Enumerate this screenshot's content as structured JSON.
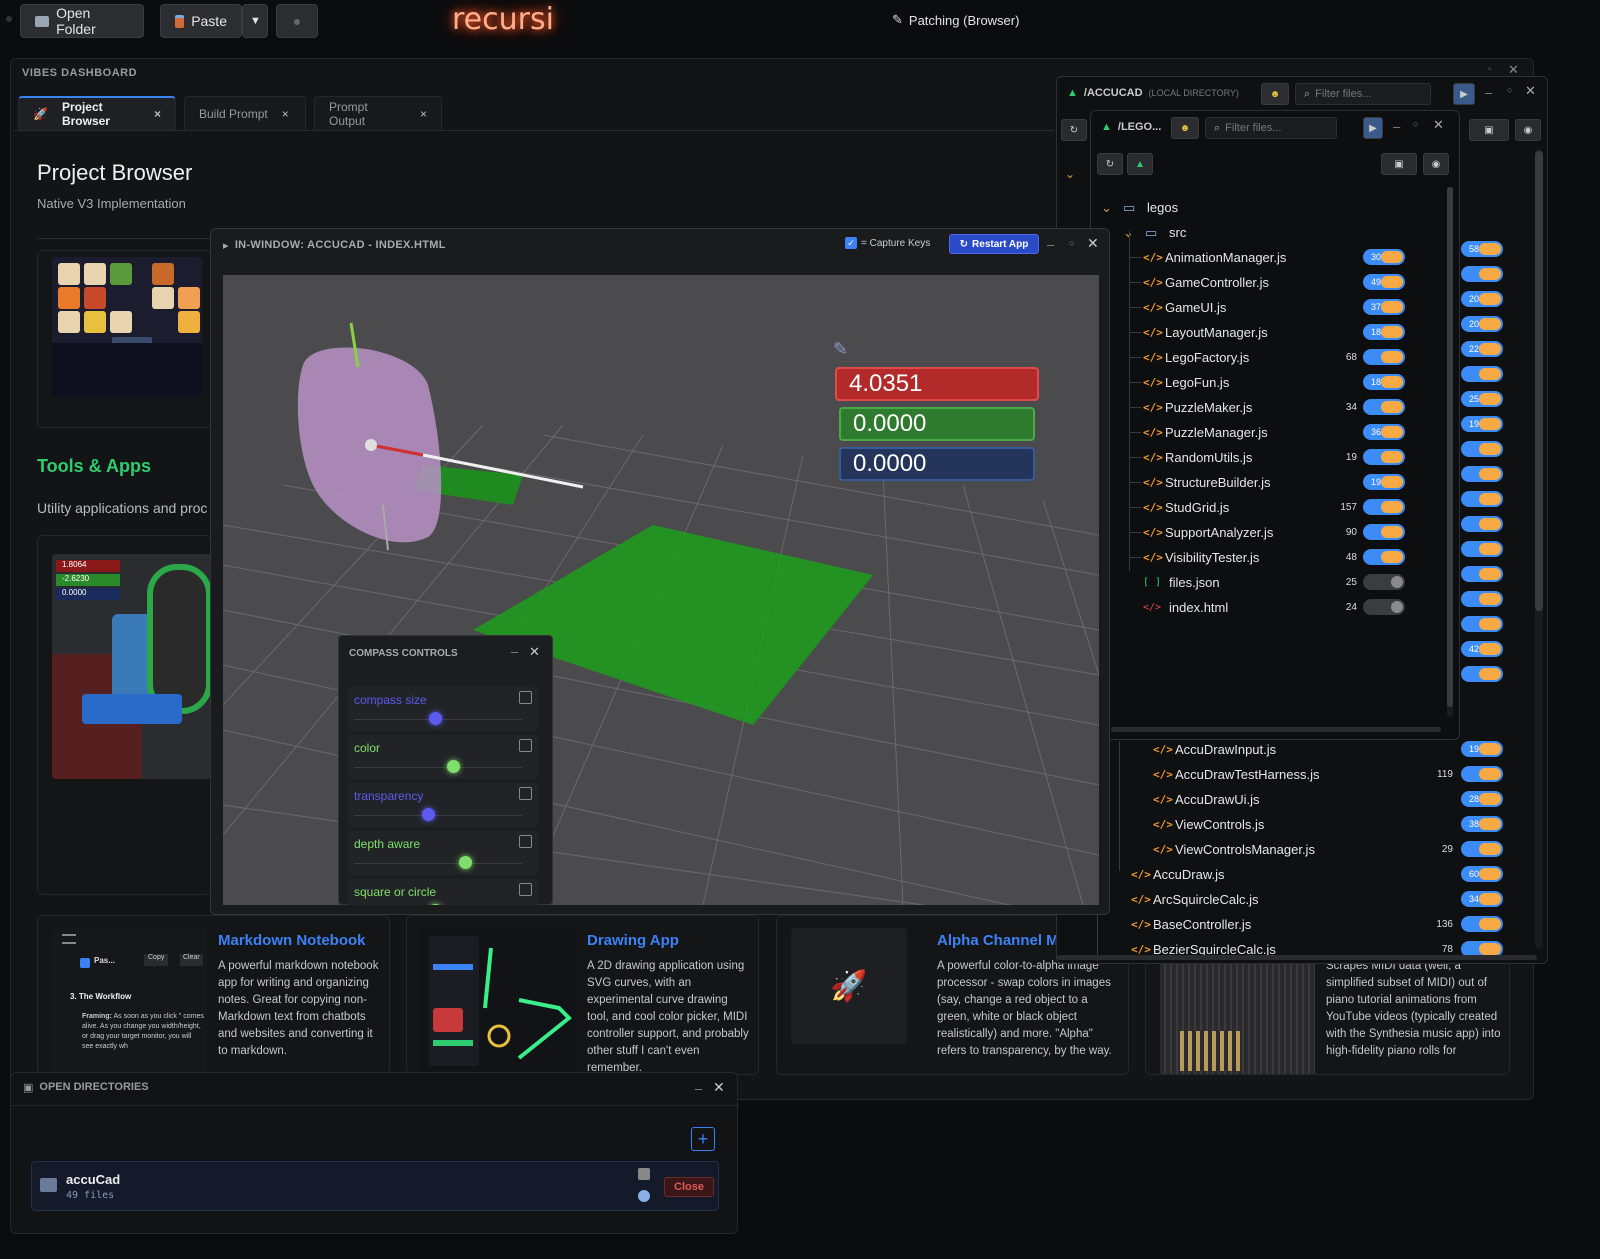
{
  "toolbar": {
    "open_folder": "Open Folder",
    "paste": "Paste",
    "paste_dropdown": "▼",
    "brand": "recursi",
    "status": "Patching (Browser)"
  },
  "dashboard": {
    "title": "VIBES DASHBOARD",
    "tabs": [
      {
        "label": "Project Browser",
        "close": "×"
      },
      {
        "label": "Build Prompt",
        "close": "×"
      },
      {
        "label": "Prompt Output",
        "close": "×"
      }
    ],
    "heading": "Project Browser",
    "subheading": "Native V3 Implementation",
    "section_title": "Tools & Apps",
    "section_desc": "Utility applications and proc",
    "cards": [
      {
        "title": "Markdown Notebook",
        "desc": "A powerful markdown notebook app for writing and organizing notes. Great for copying non-Markdown text from chatbots and websites and converting it to markdown."
      },
      {
        "title": "Drawing App",
        "desc": "A 2D drawing application using SVG curves, with an experimental curve drawing tool, and cool color picker, MIDI controller support, and probably other stuff I can't even remember."
      },
      {
        "title": "Alpha Channel M",
        "desc": "A powerful color-to-alpha image processor - swap colors in images (say, change a red object to a green, white or black object realistically) and more. \"Alpha\" refers to transparency, by the way."
      },
      {
        "title": "",
        "desc": "Scrapes MIDI data (well, a simplified subset of MIDI) out of piano tutorial animations from YouTube videos (typically created with the Synthesia music app) into high-fidelity piano rolls for"
      }
    ],
    "md_thumb": {
      "paste": "Pas...",
      "copy": "Copy",
      "clear": "Clear",
      "workflow": "3. The Workflow",
      "framing_label": "Framing:",
      "framing_text": "As soon as you click \" comes alive. As you change you width/height, or drag your target monitor, you will see exactly wh"
    },
    "cad_thumb": {
      "v1": "1.8064",
      "v2": "-2.6230",
      "v3": "0.0000"
    }
  },
  "accucad_window": {
    "title": "IN-WINDOW: ACCUCAD - INDEX.HTML",
    "capture_keys": "= Capture Keys",
    "capture_checked": true,
    "restart": "Restart App",
    "values": [
      "4.0351",
      "0.0000",
      "0.0000"
    ],
    "compass": {
      "title": "COMPASS CONTROLS",
      "controls": [
        {
          "label": "compass size",
          "color": "#5b5bf0",
          "knob": 0.5
        },
        {
          "label": "color",
          "color": "#7ee06a",
          "knob": 0.62
        },
        {
          "label": "transparency",
          "color": "#5b5bf0",
          "knob": 0.45
        },
        {
          "label": "depth aware",
          "color": "#7ee06a",
          "knob": 0.7
        },
        {
          "label": "square or circle",
          "color": "#7ee06a",
          "knob": 0.5
        }
      ]
    }
  },
  "back_file_window": {
    "path": "/ACCUCAD",
    "scope": "(LOCAL DIRECTORY)",
    "filter_placeholder": "Filter files...",
    "side_numbers": [
      "583",
      "",
      "205",
      "201",
      "228",
      "",
      "256",
      "198",
      "",
      "",
      "",
      "",
      "",
      "",
      "",
      "",
      "422",
      ""
    ],
    "files": [
      {
        "name": "AccuDrawInput.js",
        "count": "",
        "badge": "195"
      },
      {
        "name": "AccuDrawTestHarness.js",
        "count": "119",
        "badge": ""
      },
      {
        "name": "AccuDrawUi.js",
        "count": "",
        "badge": "288"
      },
      {
        "name": "ViewControls.js",
        "count": "",
        "badge": "389"
      },
      {
        "name": "ViewControlsManager.js",
        "count": "29",
        "badge": ""
      },
      {
        "name": "AccuDraw.js",
        "count": "",
        "badge": "609"
      },
      {
        "name": "ArcSquircleCalc.js",
        "count": "",
        "badge": "341"
      },
      {
        "name": "BaseController.js",
        "count": "136",
        "badge": ""
      },
      {
        "name": "BezierSquircleCalc.js",
        "count": "78",
        "badge": ""
      }
    ]
  },
  "front_file_window": {
    "path": "/LEGO...",
    "filter_placeholder": "Filter files...",
    "root": "legos",
    "src": "src",
    "files": [
      {
        "name": "AnimationManager.js",
        "count": "",
        "badge": "301",
        "on": true
      },
      {
        "name": "GameController.js",
        "count": "",
        "badge": "491",
        "on": true
      },
      {
        "name": "GameUI.js",
        "count": "",
        "badge": "378",
        "on": true
      },
      {
        "name": "LayoutManager.js",
        "count": "",
        "badge": "181",
        "on": true
      },
      {
        "name": "LegoFactory.js",
        "count": "68",
        "badge": "",
        "on": true
      },
      {
        "name": "LegoFun.js",
        "count": "",
        "badge": "187",
        "on": true
      },
      {
        "name": "PuzzleMaker.js",
        "count": "34",
        "badge": "",
        "on": true
      },
      {
        "name": "PuzzleManager.js",
        "count": "",
        "badge": "362",
        "on": true
      },
      {
        "name": "RandomUtils.js",
        "count": "19",
        "badge": "",
        "on": true
      },
      {
        "name": "StructureBuilder.js",
        "count": "",
        "badge": "195",
        "on": true
      },
      {
        "name": "StudGrid.js",
        "count": "157",
        "badge": "",
        "on": true
      },
      {
        "name": "SupportAnalyzer.js",
        "count": "90",
        "badge": "",
        "on": true
      },
      {
        "name": "VisibilityTester.js",
        "count": "48",
        "badge": "",
        "on": true
      }
    ],
    "root_files": [
      {
        "name": "files.json",
        "count": "25",
        "on": false,
        "icon": "[ ]"
      },
      {
        "name": "index.html",
        "count": "24",
        "on": false,
        "icon": "</>"
      }
    ]
  },
  "open_dirs": {
    "title": "OPEN DIRECTORIES",
    "add": "+",
    "dir_name": "accuCad",
    "dir_files": "49 files",
    "close": "Close"
  },
  "colors": {
    "accent": "#3b82f6",
    "brand": "#ff8a5c",
    "pill": "#3b8cf7",
    "pill_knob": "#f7a945",
    "green": "#2e9a2e",
    "red": "#b22a2a"
  }
}
